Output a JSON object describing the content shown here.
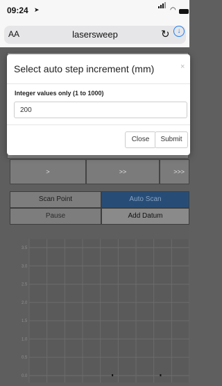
{
  "status_bar": {
    "time": "09:24"
  },
  "browser": {
    "text_size": "AA",
    "site": "lasersweep"
  },
  "dialog": {
    "title": "Select auto step increment (mm)",
    "close_glyph": "×",
    "input_label": "Integer values only (1 to 1000)",
    "input_value": "200",
    "close_label": "Close",
    "submit_label": "Submit"
  },
  "step_buttons": [
    ">",
    ">>",
    ">>>"
  ],
  "mode_buttons": {
    "scan_point": "Scan Point",
    "auto_scan": "Auto Scan",
    "pause": "Pause",
    "add_datum": "Add Datum"
  },
  "colors": {
    "active_mode": "#274d77",
    "dim_background": "#5e5e5e"
  },
  "chart_data": {
    "type": "scatter",
    "y_ticks": [
      "3.5",
      "3.0",
      "2.5",
      "2.0",
      "1.5",
      "1.0",
      "0.5",
      "0.0"
    ],
    "ylim": [
      0,
      3.5
    ],
    "grid": true,
    "points": [
      {
        "x": 0.52,
        "y": 0.0
      },
      {
        "x": 0.82,
        "y": 0.0
      }
    ]
  }
}
